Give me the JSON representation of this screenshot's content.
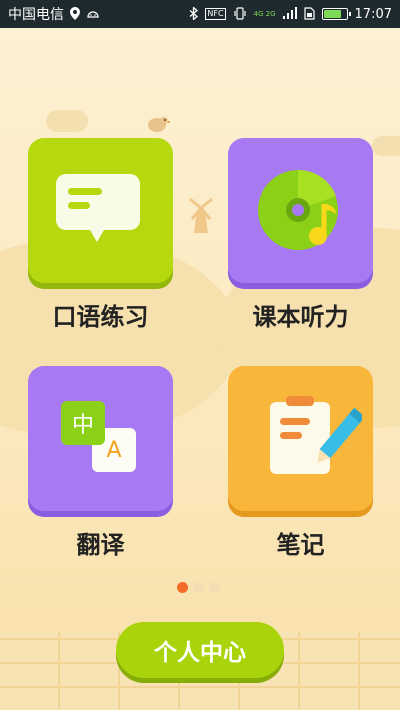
{
  "status_bar": {
    "carrier": "中国电信",
    "nfc": "NFC",
    "network": "4G 2G",
    "time": "17:07",
    "battery_fraction": 0.85
  },
  "menu": {
    "items": [
      {
        "label": "口语练习",
        "icon": "chat-bubble-icon"
      },
      {
        "label": "课本听力",
        "icon": "music-disc-icon"
      },
      {
        "label": "翻译",
        "icon": "translate-icon",
        "glyph_zh": "中",
        "glyph_en": "A"
      },
      {
        "label": "笔记",
        "icon": "notepad-pencil-icon"
      }
    ]
  },
  "pager": {
    "pages": 3,
    "active": 1
  },
  "bottom": {
    "center_button": "个人中心"
  },
  "colors": {
    "green": "#b6d80f",
    "purple": "#a77af3",
    "orange": "#f8b73a",
    "active_dot": "#f46b2a"
  }
}
